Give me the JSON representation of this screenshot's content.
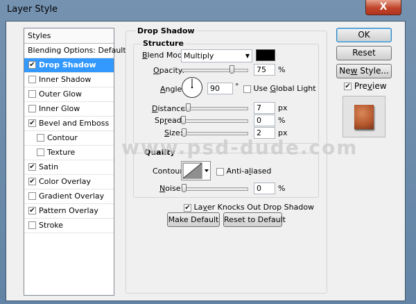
{
  "window": {
    "title": "Layer Style",
    "close_label": "X"
  },
  "styles_list": {
    "header": "Styles",
    "blending_options": "Blending Options: Default",
    "items": [
      {
        "label": "Drop Shadow",
        "checked": true,
        "selected": true,
        "sub": false
      },
      {
        "label": "Inner Shadow",
        "checked": false,
        "selected": false,
        "sub": false
      },
      {
        "label": "Outer Glow",
        "checked": false,
        "selected": false,
        "sub": false
      },
      {
        "label": "Inner Glow",
        "checked": false,
        "selected": false,
        "sub": false
      },
      {
        "label": "Bevel and Emboss",
        "checked": true,
        "selected": false,
        "sub": false
      },
      {
        "label": "Contour",
        "checked": false,
        "selected": false,
        "sub": true
      },
      {
        "label": "Texture",
        "checked": false,
        "selected": false,
        "sub": true
      },
      {
        "label": "Satin",
        "checked": true,
        "selected": false,
        "sub": false
      },
      {
        "label": "Color Overlay",
        "checked": true,
        "selected": false,
        "sub": false
      },
      {
        "label": "Gradient Overlay",
        "checked": false,
        "selected": false,
        "sub": false
      },
      {
        "label": "Pattern Overlay",
        "checked": true,
        "selected": false,
        "sub": false
      },
      {
        "label": "Stroke",
        "checked": false,
        "selected": false,
        "sub": false
      }
    ]
  },
  "drop_shadow": {
    "section_title": "Drop Shadow",
    "structure": {
      "title": "Structure",
      "blend_mode_label_u": "B",
      "blend_mode_label_rest": "lend Mode:",
      "blend_mode_value": "Multiply",
      "shadow_color": "#000000",
      "opacity_label_u": "O",
      "opacity_label_rest": "pacity:",
      "opacity_value": "75",
      "opacity_unit": "%",
      "opacity_fraction": 0.75,
      "angle_label_u": "A",
      "angle_label_rest": "ngle:",
      "angle_value": "90",
      "angle_unit": "°",
      "use_global_light_label_pre": "Use ",
      "use_global_light_label_u": "G",
      "use_global_light_label_rest": "lobal Light",
      "use_global_light_checked": false,
      "distance_label_u": "D",
      "distance_label_rest": "istance:",
      "distance_value": "7",
      "distance_unit": "px",
      "spread_label_pre": "Sp",
      "spread_label_u": "r",
      "spread_label_rest": "ead:",
      "spread_value": "0",
      "spread_unit": "%",
      "size_label_u": "S",
      "size_label_rest": "ize:",
      "size_value": "2",
      "size_unit": "px"
    },
    "quality": {
      "title": "Quality",
      "contour_label": "Contour:",
      "anti_aliased_label_pre": "Anti-a",
      "anti_aliased_label_u": "l",
      "anti_aliased_label_rest": "iased",
      "anti_aliased_checked": false,
      "noise_label_u": "N",
      "noise_label_rest": "oise:",
      "noise_value": "0",
      "noise_unit": "%"
    },
    "knocks_out_label_pre": "La",
    "knocks_out_label_u": "y",
    "knocks_out_label_rest": "er Knocks Out Drop Shadow",
    "knocks_out_checked": true,
    "make_default_label": "Make Default",
    "reset_default_label": "Reset to Default"
  },
  "actions": {
    "ok_label": "OK",
    "reset_label": "Reset",
    "new_style_label_pre": "Ne",
    "new_style_label_u": "w",
    "new_style_label_rest": " Style...",
    "preview_label_pre": "Pre",
    "preview_label_u": "v",
    "preview_label_rest": "iew",
    "preview_checked": true
  },
  "watermark_text": "www.psd-dude.com",
  "icons": {
    "checkbox_checked": "✔",
    "dropdown_arrow": "▼",
    "contour_curve": "linear-contour-icon"
  }
}
